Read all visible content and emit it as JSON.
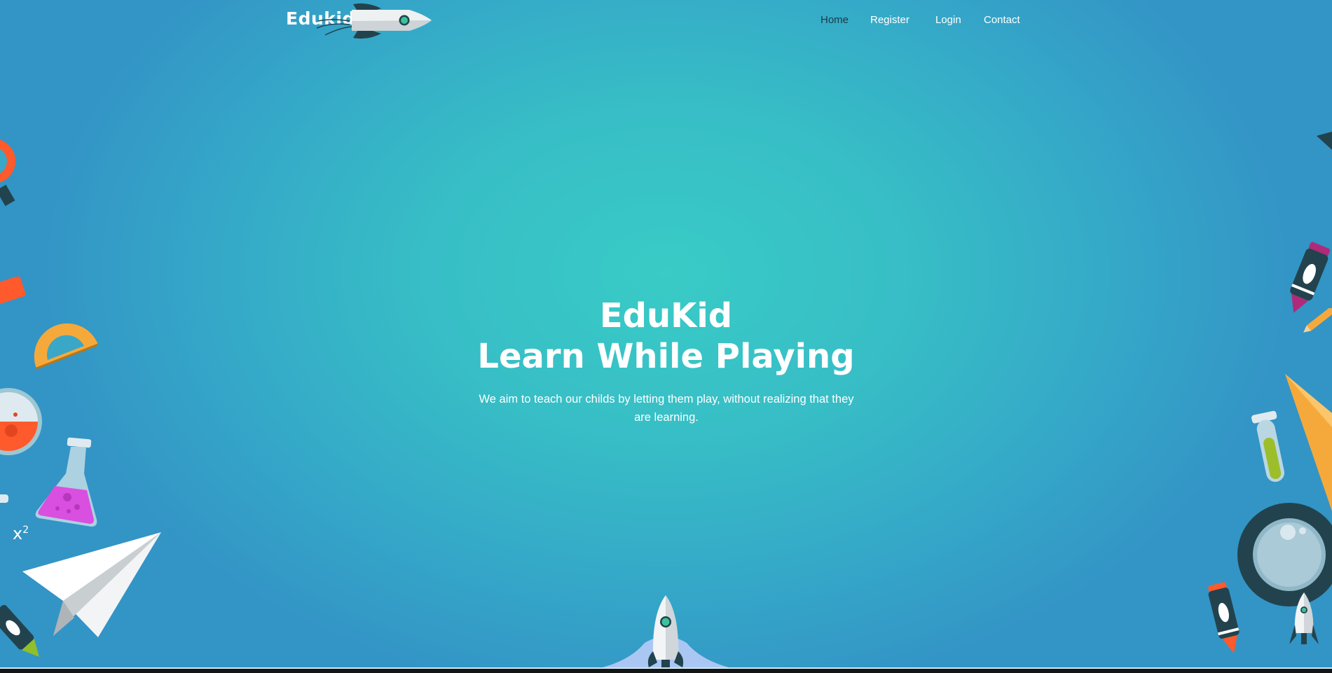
{
  "header": {
    "logo_text": "Edukids",
    "nav": [
      {
        "label": "Home",
        "active": true
      },
      {
        "label": "Register",
        "active": false
      },
      {
        "label": "Login",
        "active": false
      },
      {
        "label": "Contact",
        "active": false
      }
    ]
  },
  "hero": {
    "title_line1": "EduKid",
    "title_line2": "Learn While Playing",
    "subtitle": "We aim to teach our childs by letting them play, without realizing that they are learning."
  },
  "decorations": {
    "formula": "x",
    "formula_exp": "2"
  },
  "colors": {
    "accent_orange": "#ff5a2c",
    "accent_yellow": "#f6a93b",
    "teal_bg": "#37c4c6",
    "blue_bg": "#3394c6",
    "dark_teal": "#22434d",
    "magenta": "#d94fe0"
  }
}
